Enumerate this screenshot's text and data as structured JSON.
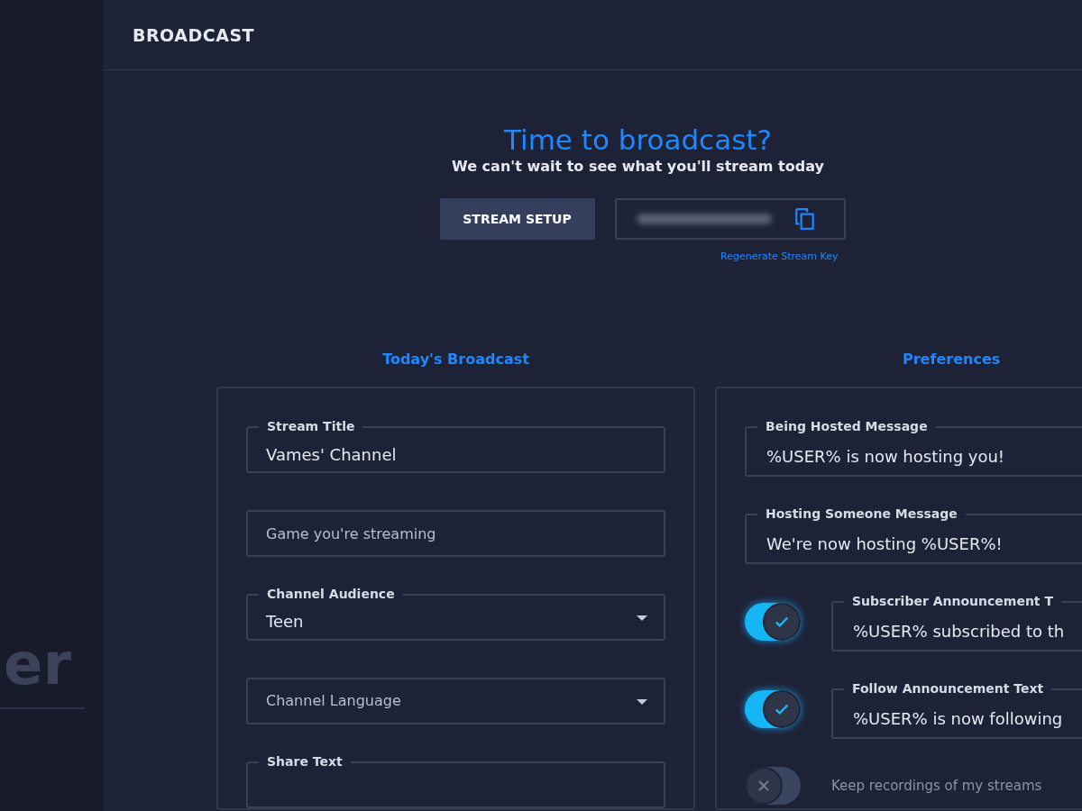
{
  "sidebar": {
    "brand_fragment": "er"
  },
  "header": {
    "title": "BROADCAST"
  },
  "hero": {
    "title": "Time to broadcast?",
    "subtitle": "We can't wait to see what you'll stream today",
    "setup_button": "STREAM SETUP",
    "regenerate_link": "Regenerate Stream Key"
  },
  "todays_broadcast": {
    "heading": "Today's Broadcast",
    "fields": [
      {
        "kind": "text",
        "label": "Stream Title",
        "value": "Vames' Channel"
      },
      {
        "kind": "text",
        "placeholder": "Game you're streaming"
      },
      {
        "kind": "select",
        "label": "Channel Audience",
        "value": "Teen"
      },
      {
        "kind": "select",
        "placeholder": "Channel Language"
      },
      {
        "kind": "text",
        "label": "Share Text"
      }
    ]
  },
  "preferences": {
    "heading": "Preferences",
    "items": [
      {
        "kind": "field",
        "label": "Being Hosted Message",
        "value": "%USER% is now hosting you!"
      },
      {
        "kind": "field",
        "label": "Hosting Someone Message",
        "value": "We're now hosting %USER%!"
      },
      {
        "kind": "toggle-field",
        "on": true,
        "label": "Subscriber Announcement T",
        "value": "%USER% subscribed to th"
      },
      {
        "kind": "toggle-field",
        "on": true,
        "label": "Follow Announcement Text",
        "value": "%USER% is now following"
      },
      {
        "kind": "toggle",
        "on": false,
        "label": "Keep recordings of my streams"
      }
    ]
  }
}
